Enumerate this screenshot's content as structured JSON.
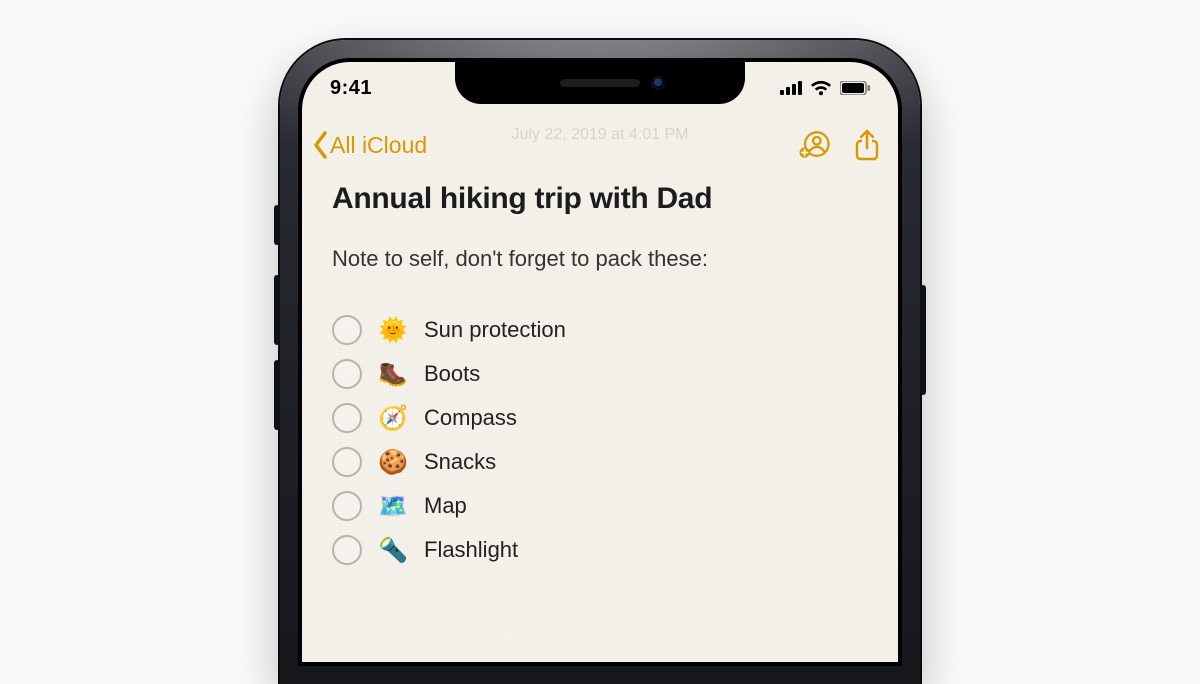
{
  "status": {
    "time": "9:41"
  },
  "nav": {
    "back_label": "All iCloud"
  },
  "faint_subtitle": "July 22, 2019 at 4:01 PM",
  "note": {
    "title": "Annual hiking trip with Dad",
    "subtitle": "Note to self, don't forget to pack these:",
    "items": [
      {
        "emoji": "🌞",
        "label": "Sun protection"
      },
      {
        "emoji": "🥾",
        "label": "Boots"
      },
      {
        "emoji": "🧭",
        "label": "Compass"
      },
      {
        "emoji": "🍪",
        "label": "Snacks"
      },
      {
        "emoji": "🗺️",
        "label": "Map"
      },
      {
        "emoji": "🔦",
        "label": "Flashlight"
      }
    ]
  }
}
